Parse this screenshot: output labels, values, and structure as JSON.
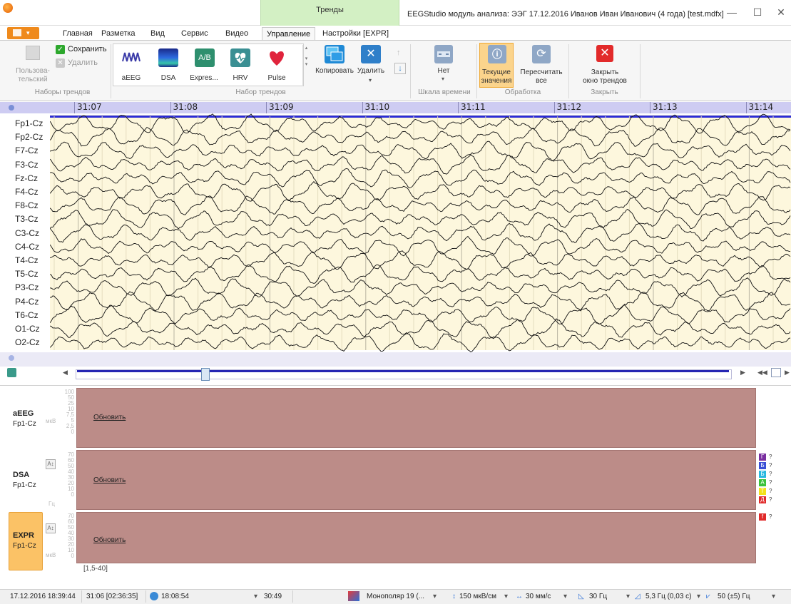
{
  "window": {
    "title": "EEGStudio модуль анализа: ЭЭГ 17.12.2016 Иванов Иван Иванович (4 года) [test.mdfx]",
    "context_tab": "Тренды",
    "controls": {
      "minimize": "—",
      "maximize": "☐",
      "close": "✕"
    }
  },
  "ribbon_tabs": [
    "Главная",
    "Разметка",
    "Вид",
    "Сервис",
    "Видео",
    "Управление",
    "Настройки [EXPR]"
  ],
  "active_tab": "Управление",
  "ribbon": {
    "user_label_1": "Пользова-",
    "user_label_2": "тельский",
    "save": "Сохранить",
    "delete_set": "Удалить",
    "group_trend_sets": "Наборы трендов",
    "trend_items": [
      "aEEG",
      "DSA",
      "Expres...",
      "HRV",
      "Pulse"
    ],
    "copy": "Копировать",
    "delete": "Удалить",
    "group_trend_set": "Набор трендов",
    "time_scale_value": "Нет",
    "group_time_scale": "Шкала времени",
    "current_values_1": "Текущие",
    "current_values_2": "значения",
    "recalc_1": "Пересчитать",
    "recalc_2": "все",
    "group_processing": "Обработка",
    "close_trends_1": "Закрыть",
    "close_trends_2": "окно трендов",
    "group_close": "Закрыть"
  },
  "time_ruler": [
    "31:07",
    "31:08",
    "31:09",
    "31:10",
    "31:11",
    "31:12",
    "31:13",
    "31:14"
  ],
  "channels": [
    "Fp1-Cz",
    "Fp2-Cz",
    "F7-Cz",
    "F3-Cz",
    "Fz-Cz",
    "F4-Cz",
    "F8-Cz",
    "T3-Cz",
    "C3-Cz",
    "C4-Cz",
    "T4-Cz",
    "T5-Cz",
    "P3-Cz",
    "P4-Cz",
    "T6-Cz",
    "O1-Cz",
    "O2-Cz"
  ],
  "trends": [
    {
      "name": "aEEG",
      "channel": "Fp1-Cz",
      "action": "Обновить",
      "unit": "мкВ",
      "scale": [
        "100",
        "50",
        "25",
        "10",
        "7,5",
        "5",
        "2,5",
        "0"
      ]
    },
    {
      "name": "DSA",
      "channel": "Fp1-Cz",
      "action": "Обновить",
      "unit": "Гц",
      "scale": [
        "70",
        "60",
        "50",
        "40",
        "30",
        "20",
        "10",
        "0"
      ],
      "badge": "A↕"
    },
    {
      "name": "EXPR",
      "channel": "Fp1-Cz",
      "action": "Обновить",
      "unit": "мкВ",
      "scale": [
        "70",
        "60",
        "50",
        "40",
        "30",
        "20",
        "10",
        "0"
      ],
      "badge": "A↕"
    }
  ],
  "band_legend": [
    {
      "letter": "Г",
      "color": "#7a2fa0"
    },
    {
      "letter": "Б",
      "color": "#3a4fd6"
    },
    {
      "letter": "Б",
      "color": "#28b8e0"
    },
    {
      "letter": "А",
      "color": "#3ac23a"
    },
    {
      "letter": "Т",
      "color": "#f2e21a"
    },
    {
      "letter": "Д",
      "color": "#e02a2a"
    }
  ],
  "expr_legend": {
    "letter": "f",
    "color": "#e02a2a"
  },
  "band_question": "?",
  "range_label": "[1,5-40]",
  "status": {
    "datetime": "17.12.2016 18:39:44",
    "position": "31:06 [02:36:35]",
    "clock": "18:08:54",
    "duration": "30:49",
    "montage": "Монополяр 19 (...",
    "sensitivity": "150 мкВ/см",
    "speed": "30 мм/с",
    "lowpass": "30 Гц",
    "highpass": "5,3 Гц (0,03 с)",
    "notch": "50 (±5) Гц"
  }
}
